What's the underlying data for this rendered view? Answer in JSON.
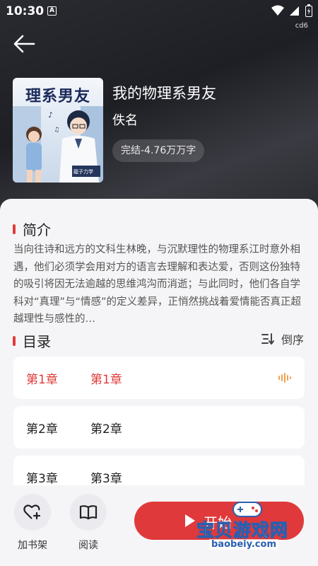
{
  "status_bar": {
    "time": "10:30",
    "a_badge": "A",
    "tag": "cd6"
  },
  "book": {
    "cover_title": "理系男友",
    "cover_badge": "龍子力学",
    "title": "我的物理系男友",
    "author": "佚名",
    "status": "完结-4.76万万字"
  },
  "intro": {
    "heading": "简介",
    "text": "当向往诗和远方的文科生林晚，与沉默理性的物理系江时意外相遇，他们必须学会用对方的语言去理解和表达爱，否则这份独特的吸引将因无法逾越的思维鸿沟而消逝；与此同时，他们各自学科对“真理”与“情感”的定义差异，正悄然挑战着爱情能否真正超越理性与感性的…"
  },
  "catalog": {
    "heading": "目录",
    "order_label": "倒序",
    "chapters": [
      {
        "num": "第1章",
        "name": "第1章",
        "active": true
      },
      {
        "num": "第2章",
        "name": "第2章",
        "active": false
      },
      {
        "num": "第3章",
        "name": "第3章",
        "active": false
      }
    ]
  },
  "actions": {
    "add_shelf": "加书架",
    "read": "阅读",
    "start": "开始"
  },
  "watermark": {
    "text": "宝贝游戏网",
    "url": "baobeiy.com"
  },
  "colors": {
    "accent": "#e23a3a",
    "hero_bg": "#24252a",
    "sheet_bg": "#f5f5f7"
  }
}
